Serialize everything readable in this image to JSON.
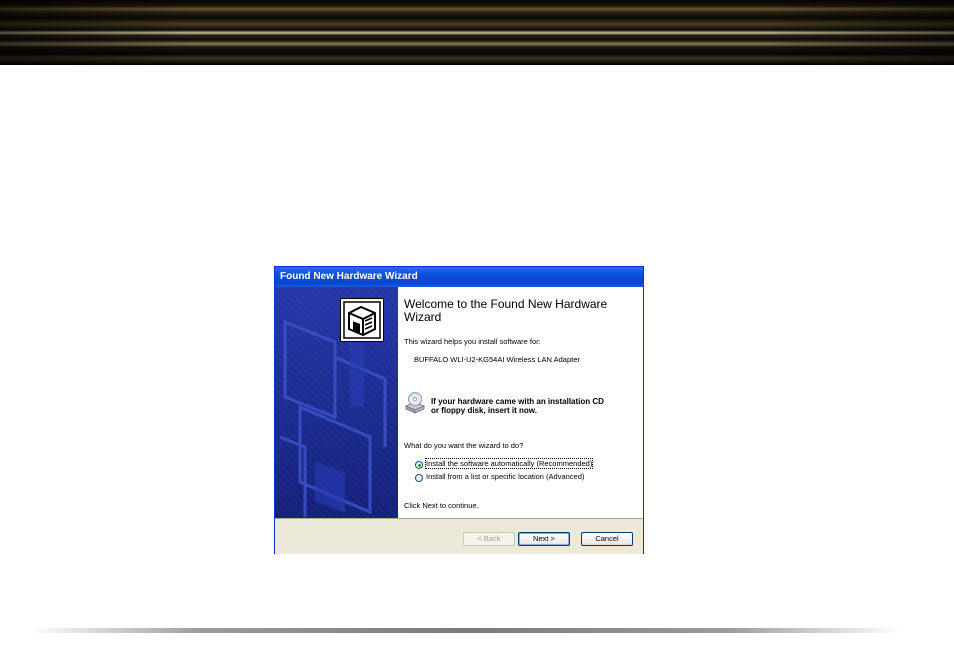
{
  "window": {
    "title": "Found New Hardware Wizard"
  },
  "content": {
    "heading": "Welcome to the Found New Hardware Wizard",
    "intro": "This wizard helps you install software for:",
    "device": "BUFFALO WLI-U2-KG54AI   Wireless LAN Adapter",
    "cd_note_line1": "If your hardware came with an installation CD",
    "cd_note_line2": "or floppy disk, insert it now.",
    "question": "What do you want the wizard to do?",
    "options": [
      {
        "label": "Install the software automatically (Recommended)",
        "selected": true
      },
      {
        "label": "Install from a list or specific location (Advanced)",
        "selected": false
      }
    ],
    "continue": "Click Next to continue."
  },
  "buttons": {
    "back": "< Back",
    "next": "Next >",
    "cancel": "Cancel"
  },
  "icons": {
    "wizard": "hardware-wizard-icon",
    "cd": "cd-drive-icon"
  },
  "colors": {
    "titlebar": "#0a4fd8",
    "side_panel": "#1d2b8c",
    "dialog_bg": "#ece9d8"
  }
}
